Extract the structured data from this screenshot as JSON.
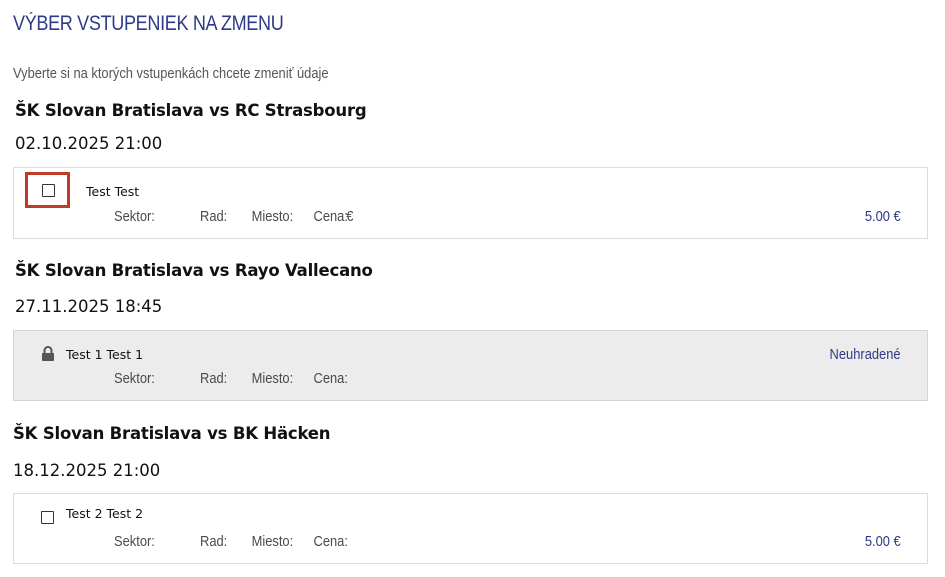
{
  "page": {
    "title": "VÝBER VSTUPENIEK NA ZMENU",
    "subtitle": "Vyberte si na ktorých vstupenkách chcete zmeniť údaje"
  },
  "matches": [
    {
      "title": "ŠK Slovan Bratislava vs RC Strasbourg",
      "date": "02.10.2025 21:00",
      "ticket": {
        "holder": "Test Test",
        "sector_label": "Sektor:",
        "row_label": "Rad:",
        "seat_label": "Miesto:",
        "price_label": "Cena:",
        "currency": "€",
        "price": "5.00 €",
        "checked": false,
        "highlighted": true
      }
    },
    {
      "title": "ŠK Slovan Bratislava vs Rayo Vallecano",
      "date": "27.11.2025 18:45",
      "ticket": {
        "holder": "Test 1 Test 1",
        "sector_label": "Sektor:",
        "row_label": "Rad:",
        "seat_label": "Miesto:",
        "price_label": "Cena:",
        "status": "Neuhradené",
        "locked": true,
        "icon": "lock-icon"
      }
    },
    {
      "title": "ŠK Slovan Bratislava vs BK Häcken",
      "date": "18.12.2025 21:00",
      "ticket": {
        "holder": "Test 2 Test 2",
        "sector_label": "Sektor:",
        "row_label": "Rad:",
        "seat_label": "Miesto:",
        "price_label": "Cena:",
        "price": "5.00 €",
        "checked": false
      }
    }
  ],
  "colors": {
    "accent": "#2e3a87",
    "highlight": "#c0392b",
    "locked_bg": "#ececec"
  }
}
